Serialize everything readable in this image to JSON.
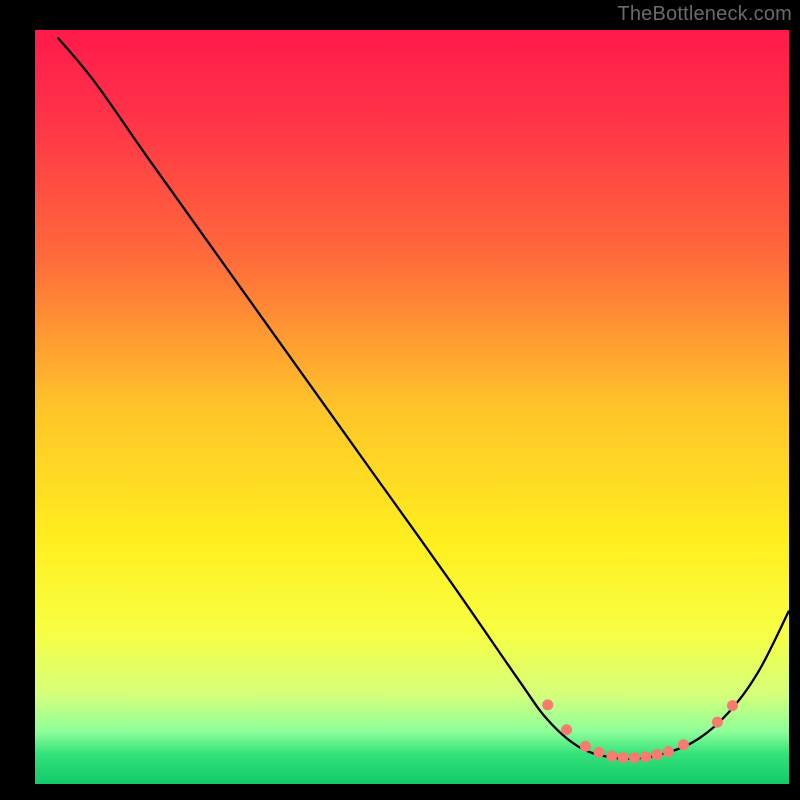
{
  "watermark": "TheBottleneck.com",
  "chart_data": {
    "type": "line",
    "title": "",
    "xlabel": "",
    "ylabel": "",
    "xlim": [
      0,
      100
    ],
    "ylim": [
      0,
      100
    ],
    "gradient_stops": [
      {
        "offset": 0,
        "color": "#ff1a4b"
      },
      {
        "offset": 12,
        "color": "#ff3448"
      },
      {
        "offset": 30,
        "color": "#ff6a3b"
      },
      {
        "offset": 50,
        "color": "#ffc42a"
      },
      {
        "offset": 68,
        "color": "#ffef1f"
      },
      {
        "offset": 80,
        "color": "#f7ff44"
      },
      {
        "offset": 88,
        "color": "#d6ff7a"
      },
      {
        "offset": 93,
        "color": "#8fff9a"
      },
      {
        "offset": 96,
        "color": "#34e27a"
      },
      {
        "offset": 100,
        "color": "#12c96a"
      }
    ],
    "series": [
      {
        "name": "bottleneck-curve",
        "points": [
          {
            "x": 3.0,
            "y": 99.0
          },
          {
            "x": 8.0,
            "y": 93.0
          },
          {
            "x": 15.0,
            "y": 83.0
          },
          {
            "x": 25.0,
            "y": 69.0
          },
          {
            "x": 35.0,
            "y": 55.0
          },
          {
            "x": 45.0,
            "y": 41.0
          },
          {
            "x": 55.0,
            "y": 27.0
          },
          {
            "x": 64.0,
            "y": 14.0
          },
          {
            "x": 68.0,
            "y": 8.5
          },
          {
            "x": 72.0,
            "y": 5.0
          },
          {
            "x": 76.0,
            "y": 3.6
          },
          {
            "x": 80.0,
            "y": 3.4
          },
          {
            "x": 84.0,
            "y": 4.2
          },
          {
            "x": 88.0,
            "y": 6.0
          },
          {
            "x": 92.0,
            "y": 9.5
          },
          {
            "x": 96.0,
            "y": 15.0
          },
          {
            "x": 100.0,
            "y": 23.0
          }
        ]
      }
    ],
    "marker_points": [
      {
        "x": 68.0,
        "y": 10.5
      },
      {
        "x": 70.5,
        "y": 7.2
      },
      {
        "x": 73.0,
        "y": 5.0
      },
      {
        "x": 74.8,
        "y": 4.2
      },
      {
        "x": 76.5,
        "y": 3.7
      },
      {
        "x": 78.0,
        "y": 3.5
      },
      {
        "x": 79.5,
        "y": 3.5
      },
      {
        "x": 81.0,
        "y": 3.6
      },
      {
        "x": 82.5,
        "y": 3.9
      },
      {
        "x": 84.0,
        "y": 4.3
      },
      {
        "x": 86.0,
        "y": 5.2
      },
      {
        "x": 90.5,
        "y": 8.2
      },
      {
        "x": 92.5,
        "y": 10.4
      }
    ]
  }
}
